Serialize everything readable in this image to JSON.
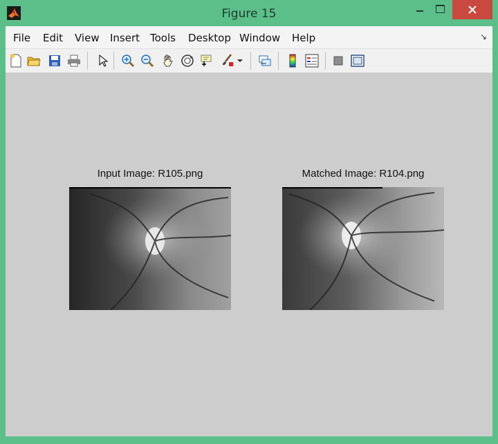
{
  "window": {
    "title": "Figure 15"
  },
  "menu": {
    "items": [
      "File",
      "Edit",
      "View",
      "Insert",
      "Tools",
      "Desktop",
      "Window",
      "Help"
    ],
    "overflow_arrow": "↘"
  },
  "toolbar": {
    "icons": [
      "new-figure-icon",
      "open-file-icon",
      "save-icon",
      "print-icon",
      "edit-plot-icon",
      "zoom-in-icon",
      "zoom-out-icon",
      "pan-icon",
      "rotate-3d-icon",
      "data-cursor-icon",
      "brush-icon",
      "link-plot-icon",
      "insert-colorbar-icon",
      "insert-legend-icon",
      "hide-plot-tools-icon",
      "show-plot-tools-icon"
    ]
  },
  "figure": {
    "left_title": "Input Image: R105.png",
    "right_title": "Matched Image: R104.png"
  },
  "colors": {
    "titlebar": "#5cbf8a",
    "close_button": "#c9483f",
    "canvas": "#cdcdcd"
  }
}
